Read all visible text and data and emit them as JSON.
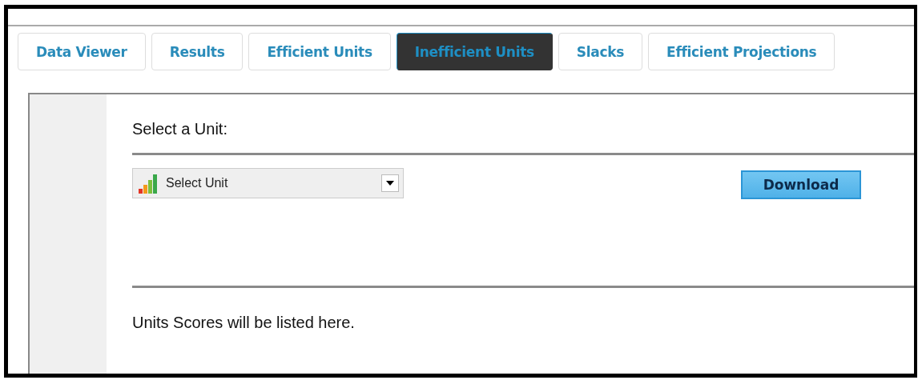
{
  "tabs": [
    {
      "label": "Data Viewer",
      "selected": false
    },
    {
      "label": "Results",
      "selected": false
    },
    {
      "label": "Efficient Units",
      "selected": false
    },
    {
      "label": "Inefficient Units",
      "selected": true
    },
    {
      "label": "Slacks",
      "selected": false
    },
    {
      "label": "Efficient Projections",
      "selected": false
    }
  ],
  "panel": {
    "heading": "Select a Unit:",
    "unit_select": {
      "value": "Select Unit"
    },
    "download_button": "Download",
    "message": "Units Scores will be listed here."
  }
}
